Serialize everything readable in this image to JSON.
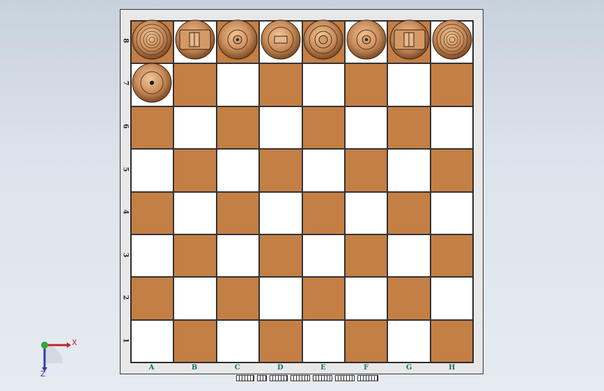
{
  "board": {
    "ranks": [
      "8",
      "7",
      "6",
      "5",
      "4",
      "3",
      "2",
      "1"
    ],
    "files": [
      "A",
      "B",
      "C",
      "D",
      "E",
      "F",
      "G",
      "H"
    ]
  },
  "colors": {
    "dark_square": "#c47f45",
    "light_square": "#ffffff",
    "piece_wood": "#c98c5a",
    "axis_x": "#c0262c",
    "axis_y": "#2eaa3a",
    "axis_z": "#2b3fa8"
  },
  "pieces": [
    {
      "square": "A8",
      "type": "rook-icon"
    },
    {
      "square": "B8",
      "type": "knight-icon"
    },
    {
      "square": "C8",
      "type": "bishop-icon"
    },
    {
      "square": "D8",
      "type": "queen-icon"
    },
    {
      "square": "E8",
      "type": "king-icon"
    },
    {
      "square": "F8",
      "type": "bishop-icon"
    },
    {
      "square": "G8",
      "type": "knight-icon"
    },
    {
      "square": "H8",
      "type": "rook-icon"
    },
    {
      "square": "A7",
      "type": "pawn-icon"
    }
  ],
  "triad": {
    "x_label": "X",
    "z_label": "Z"
  }
}
